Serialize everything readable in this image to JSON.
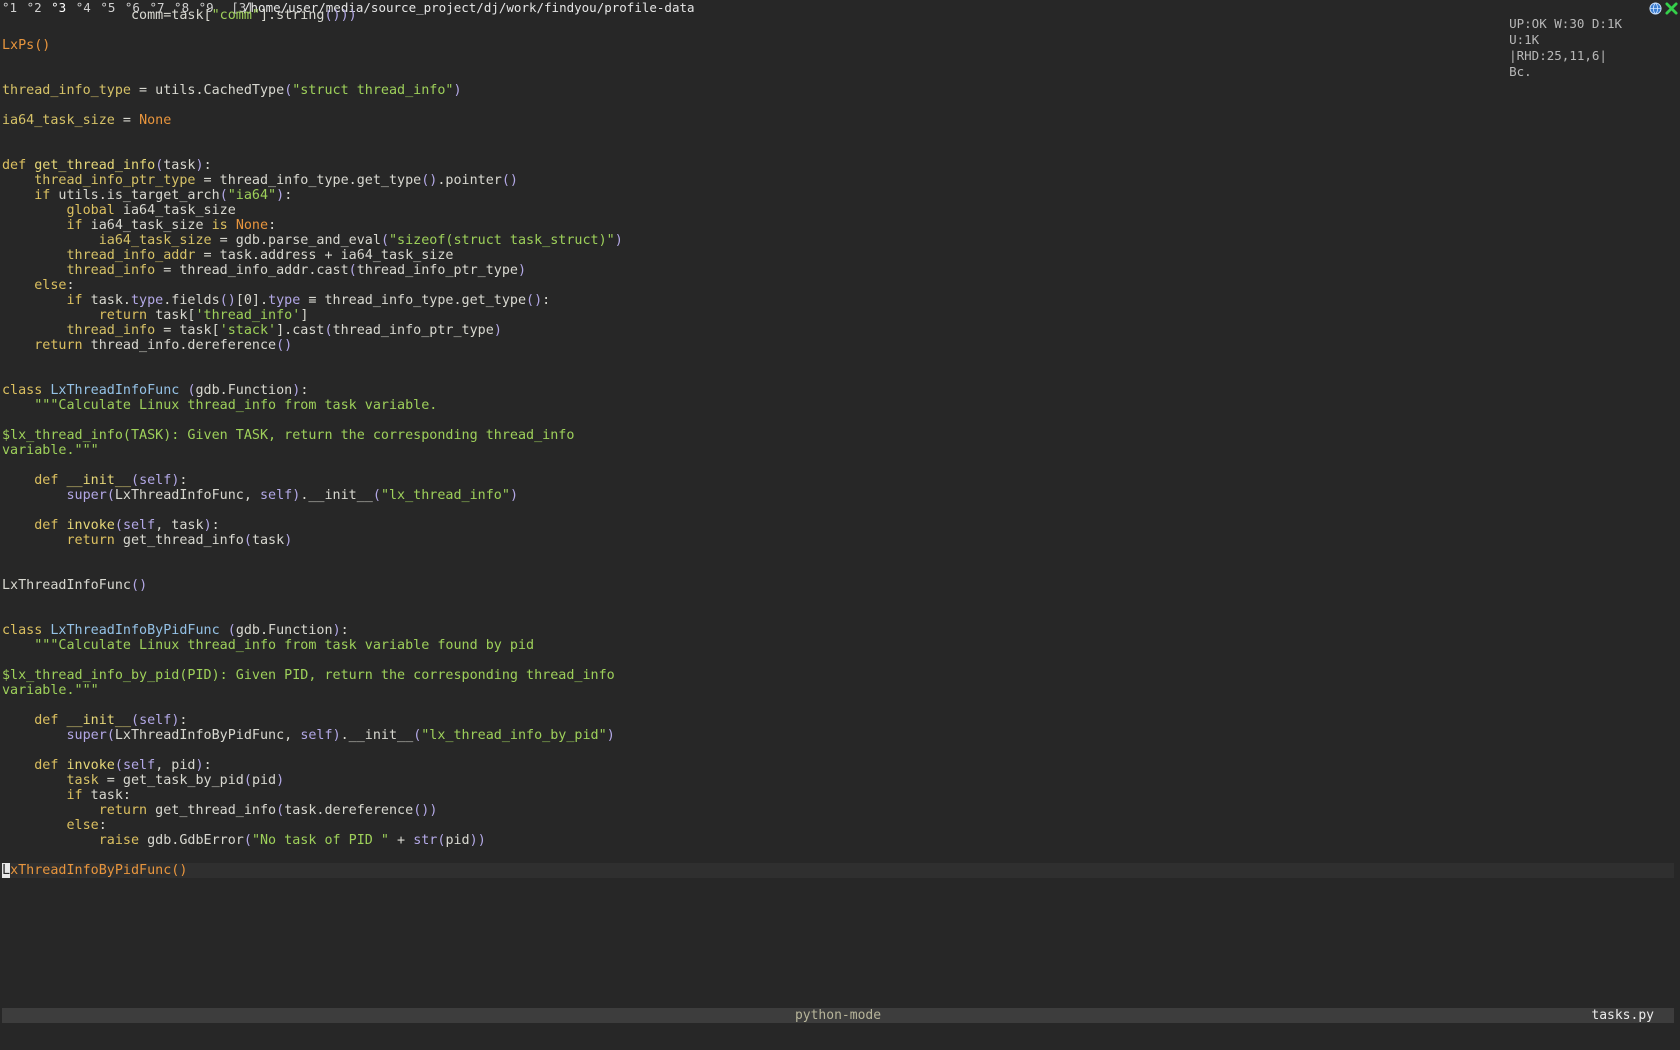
{
  "topbar": {
    "workspaces": [
      "1",
      "2",
      "3",
      "4",
      "5",
      "6",
      "7",
      "8",
      "9"
    ],
    "active_workspace": "3",
    "selected": "[3]",
    "path": "/home/user/media/source_project/dj/work/findyou/profile-data",
    "status": {
      "net": "UP:OK W:30 D:1K",
      "upload": "U:1K",
      "disk": "|RHD:25,11,6|",
      "extra": "Bc."
    },
    "tray_icons": [
      "globe-icon",
      "close-x-icon"
    ]
  },
  "editor": {
    "language": "python",
    "lines": [
      "                comm=task[\"comm\"].string()))",
      "",
      "LxPs()",
      "",
      "",
      "thread_info_type = utils.CachedType(\"struct thread_info\")",
      "",
      "ia64_task_size = None",
      "",
      "",
      "def get_thread_info(task):",
      "    thread_info_ptr_type = thread_info_type.get_type().pointer()",
      "    if utils.is_target_arch(\"ia64\"):",
      "        global ia64_task_size",
      "        if ia64_task_size is None:",
      "            ia64_task_size = gdb.parse_and_eval(\"sizeof(struct task_struct)\")",
      "        thread_info_addr = task.address + ia64_task_size",
      "        thread_info = thread_info_addr.cast(thread_info_ptr_type)",
      "    else:",
      "        if task.type.fields()[0].type ≡ thread_info_type.get_type():",
      "            return task['thread_info']",
      "        thread_info = task['stack'].cast(thread_info_ptr_type)",
      "    return thread_info.dereference()",
      "",
      "",
      "class LxThreadInfoFunc (gdb.Function):",
      "    \"\"\"Calculate Linux thread_info from task variable.",
      "",
      "$lx_thread_info(TASK): Given TASK, return the corresponding thread_info",
      "variable.\"\"\"",
      "",
      "    def __init__(self):",
      "        super(LxThreadInfoFunc, self).__init__(\"lx_thread_info\")",
      "",
      "    def invoke(self, task):",
      "        return get_thread_info(task)",
      "",
      "",
      "LxThreadInfoFunc()",
      "",
      "",
      "class LxThreadInfoByPidFunc (gdb.Function):",
      "    \"\"\"Calculate Linux thread_info from task variable found by pid",
      "",
      "$lx_thread_info_by_pid(PID): Given PID, return the corresponding thread_info",
      "variable.\"\"\"",
      "",
      "    def __init__(self):",
      "        super(LxThreadInfoByPidFunc, self).__init__(\"lx_thread_info_by_pid\")",
      "",
      "    def invoke(self, pid):",
      "        task = get_task_by_pid(pid)",
      "        if task:",
      "            return get_thread_info(task.dereference())",
      "        else:",
      "            raise gdb.GdbError(\"No task of PID \" + str(pid))",
      "",
      "LxThreadInfoByPidFunc()"
    ],
    "cursor_line": 57
  },
  "modeline": {
    "mode": "python-mode",
    "file": "tasks.py"
  },
  "colors": {
    "background": "#272727",
    "keyword": "#dcc060",
    "string": "#9ed05a",
    "constant": "#e8953d",
    "builtin": "#b3a8e6",
    "class_name": "#95c2e6"
  }
}
